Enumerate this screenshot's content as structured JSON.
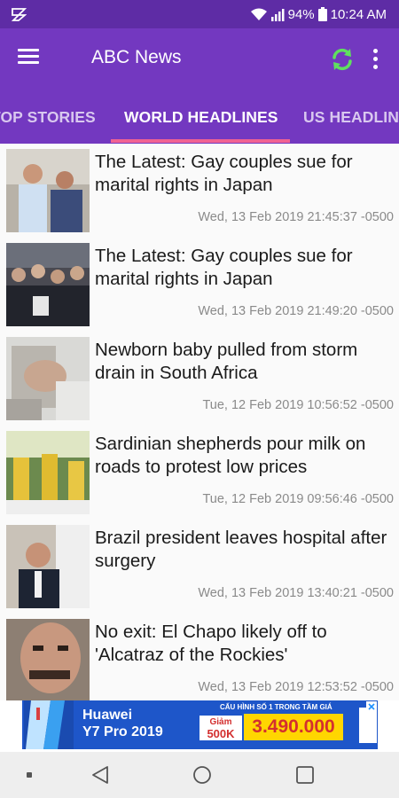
{
  "status_bar": {
    "battery": "94%",
    "time": "10:24 AM"
  },
  "app_bar": {
    "title": "ABC News",
    "icons": [
      "menu-icon",
      "refresh-icon",
      "more-vertical-icon"
    ],
    "refresh_color": "#5fe05f"
  },
  "tabs": [
    {
      "label": "TOP STORIES",
      "active": false
    },
    {
      "label": "WORLD HEADLINES",
      "active": true
    },
    {
      "label": "US HEADLIN",
      "active": false
    }
  ],
  "colors": {
    "status_bar": "#5e2ca5",
    "app_bar": "#7338c0",
    "tab_indicator": "#f06292"
  },
  "articles": [
    {
      "headline": "The Latest: Gay couples sue for marital rights in Japan",
      "date": "Wed, 13 Feb 2019 21:45:37 -0500"
    },
    {
      "headline": "The Latest: Gay couples sue for marital rights in Japan",
      "date": "Wed, 13 Feb 2019 21:49:20 -0500"
    },
    {
      "headline": "Newborn baby pulled from storm drain in South Africa",
      "date": "Tue, 12 Feb 2019 10:56:52 -0500"
    },
    {
      "headline": "Sardinian shepherds pour milk on roads to protest low prices",
      "date": "Tue, 12 Feb 2019 09:56:46 -0500"
    },
    {
      "headline": "Brazil president leaves hospital after surgery",
      "date": "Wed, 13 Feb 2019 13:40:21 -0500"
    },
    {
      "headline": "No exit: El Chapo likely off to 'Alcatraz of the Rockies'",
      "date": "Wed, 13 Feb 2019 12:53:52 -0500"
    }
  ],
  "ad": {
    "brand_line1": "Huawei",
    "brand_line2": "Y7 Pro 2019",
    "top_line": "CẤU HÌNH SỐ 1 TRONG TẦM GIÁ",
    "badge_line1": "Giảm",
    "badge_line2": "500K",
    "price": "3.490.000"
  },
  "nav_bar": {
    "icons": [
      "back-icon",
      "home-icon",
      "recents-icon"
    ]
  }
}
